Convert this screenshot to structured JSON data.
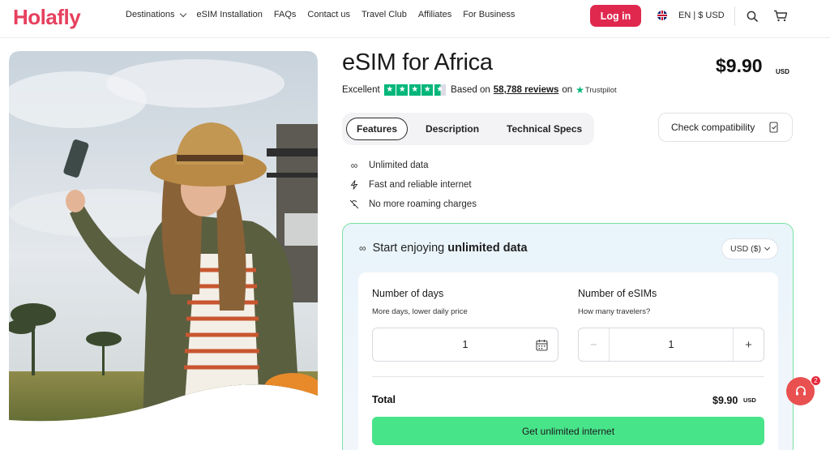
{
  "brand": {
    "logo_text": "Holafly",
    "accent_color": "#e6405e"
  },
  "nav": {
    "items": [
      {
        "label": "Destinations",
        "has_dropdown": true
      },
      {
        "label": "eSIM Installation"
      },
      {
        "label": "FAQs"
      },
      {
        "label": "Contact us"
      },
      {
        "label": "Travel Club"
      },
      {
        "label": "Affiliates"
      },
      {
        "label": "For Business"
      }
    ],
    "login_label": "Log in",
    "language_label": "EN | $ USD",
    "icons": [
      "uk-flag-icon",
      "search-icon",
      "cart-icon"
    ]
  },
  "product": {
    "title": "eSIM for Africa",
    "price": "$9.90",
    "price_currency": "USD",
    "rating": {
      "label": "Excellent",
      "stars": 4.5,
      "based_on": "Based on",
      "reviews_link": "58,788 reviews",
      "on": "on",
      "provider": "Trustpilot"
    },
    "tabs": [
      {
        "label": "Features",
        "active": true
      },
      {
        "label": "Description",
        "active": false
      },
      {
        "label": "Technical Specs",
        "active": false
      }
    ],
    "check_compatibility": "Check compatibility",
    "features": [
      {
        "icon": "infinity-icon",
        "label": "Unlimited data"
      },
      {
        "icon": "lightning-icon",
        "label": "Fast and reliable internet"
      },
      {
        "icon": "no-roaming-icon",
        "label": "No more roaming charges"
      }
    ]
  },
  "card": {
    "heading_prefix": "Start enjoying",
    "heading_bold": "unlimited data",
    "currency_select": "USD ($)",
    "days": {
      "title": "Number of days",
      "subtitle": "More days, lower daily price",
      "value": "1"
    },
    "esims": {
      "title": "Number of eSIMs",
      "subtitle": "How many travelers?",
      "value": "1",
      "minus": "−",
      "plus": "+"
    },
    "total_label": "Total",
    "total_price": "$9.90",
    "total_currency": "USD",
    "cta_label": "Get unlimited internet",
    "border_color": "#7ee0a4",
    "cta_color": "#48e48a"
  },
  "chat": {
    "badge_count": "2"
  }
}
